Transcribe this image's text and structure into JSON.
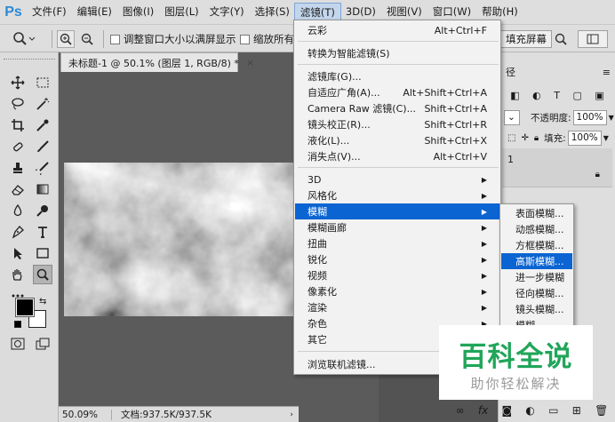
{
  "app": {
    "logo": "Ps"
  },
  "menubar": {
    "items": [
      "文件(F)",
      "编辑(E)",
      "图像(I)",
      "图层(L)",
      "文字(Y)",
      "选择(S)",
      "滤镜(T)",
      "3D(D)",
      "视图(V)",
      "窗口(W)",
      "帮助(H)"
    ],
    "active_index": 6
  },
  "options": {
    "resize_windows_label": "调整窗口大小以满屏显示",
    "zoom_all_label": "缩放所有",
    "fill_screen_button": "填充屏幕"
  },
  "document": {
    "tab_title": "未标题-1 @ 50.1% (图层 1, RGB/8) *",
    "zoom_level": "50.09%",
    "doc_info": "文档:937.5K/937.5K"
  },
  "filter_menu": {
    "items": [
      {
        "label": "云彩",
        "shortcut": "Alt+Ctrl+F"
      },
      {
        "label": "转换为智能滤镜(S)",
        "shortcut": ""
      },
      {
        "label": "滤镜库(G)...",
        "shortcut": ""
      },
      {
        "label": "自适应广角(A)...",
        "shortcut": "Alt+Shift+Ctrl+A"
      },
      {
        "label": "Camera Raw 滤镜(C)...",
        "shortcut": "Shift+Ctrl+A"
      },
      {
        "label": "镜头校正(R)...",
        "shortcut": "Shift+Ctrl+R"
      },
      {
        "label": "液化(L)...",
        "shortcut": "Shift+Ctrl+X"
      },
      {
        "label": "消失点(V)...",
        "shortcut": "Alt+Ctrl+V"
      },
      {
        "label": "3D",
        "shortcut": ""
      },
      {
        "label": "风格化",
        "shortcut": ""
      },
      {
        "label": "模糊",
        "shortcut": ""
      },
      {
        "label": "模糊画廊",
        "shortcut": ""
      },
      {
        "label": "扭曲",
        "shortcut": ""
      },
      {
        "label": "锐化",
        "shortcut": ""
      },
      {
        "label": "视频",
        "shortcut": ""
      },
      {
        "label": "像素化",
        "shortcut": ""
      },
      {
        "label": "渲染",
        "shortcut": ""
      },
      {
        "label": "杂色",
        "shortcut": ""
      },
      {
        "label": "其它",
        "shortcut": ""
      },
      {
        "label": "浏览联机滤镜...",
        "shortcut": ""
      }
    ],
    "highlighted": "模糊"
  },
  "blur_submenu": {
    "items": [
      "表面模糊...",
      "动感模糊...",
      "方框模糊...",
      "高斯模糊...",
      "进一步模糊",
      "径向模糊...",
      "镜头模糊...",
      "模糊"
    ],
    "highlighted": "高斯模糊..."
  },
  "panels": {
    "tab_label": "径",
    "opacity_label": "不透明度:",
    "opacity_value": "100%",
    "fill_label": "填充:",
    "fill_value": "100%",
    "layer_fragment": "1"
  },
  "watermark": {
    "title": "百科全说",
    "subtitle": "助你轻松解决"
  },
  "colors": {
    "menu_highlight": "#0a64d2",
    "menubar_bg": "#dedede",
    "workspace_bg": "#535353",
    "watermark_green": "#21a55a"
  }
}
